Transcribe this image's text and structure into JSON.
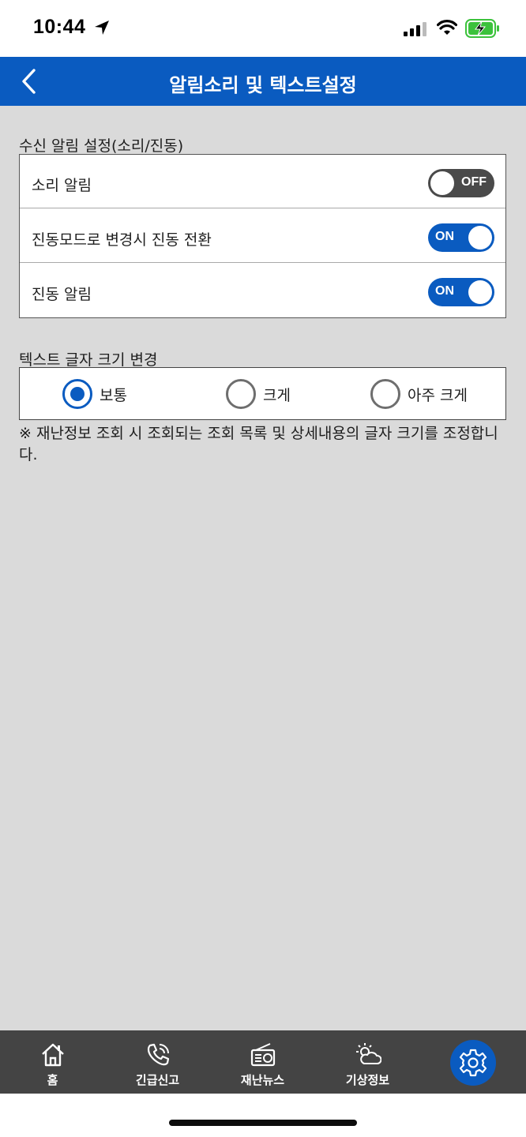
{
  "status": {
    "time": "10:44",
    "icons": [
      "location-arrow-icon",
      "cell-signal-icon",
      "wifi-icon",
      "battery-charging-icon"
    ],
    "battery_color": "#3cc23c"
  },
  "header": {
    "title": "알림소리 및 텍스트설정",
    "back_icon": "chevron-left-icon",
    "background": "#0a5bc0"
  },
  "alerts": {
    "section_label": "수신 알림 설정(소리/진동)",
    "rows": [
      {
        "label": "소리 알림",
        "toggle": "OFF"
      },
      {
        "label": "진동모드로 변경시 진동 전환",
        "toggle": "ON"
      },
      {
        "label": "진동 알림",
        "toggle": "ON"
      }
    ]
  },
  "text_size": {
    "section_label": "텍스트 글자 크기 변경",
    "options": [
      {
        "label": "보통",
        "selected": true
      },
      {
        "label": "크게",
        "selected": false
      },
      {
        "label": "아주 크게",
        "selected": false
      }
    ],
    "note": "※ 재난정보 조회 시 조회되는 조회 목록 및 상세내용의 글자 크기를 조정합니다."
  },
  "tabbar": {
    "items": [
      {
        "label": "홈",
        "icon": "home-icon"
      },
      {
        "label": "긴급신고",
        "icon": "phone-call-icon"
      },
      {
        "label": "재난뉴스",
        "icon": "radio-icon"
      },
      {
        "label": "기상정보",
        "icon": "weather-icon"
      },
      {
        "label": "",
        "icon": "gear-icon",
        "active": true
      }
    ]
  }
}
